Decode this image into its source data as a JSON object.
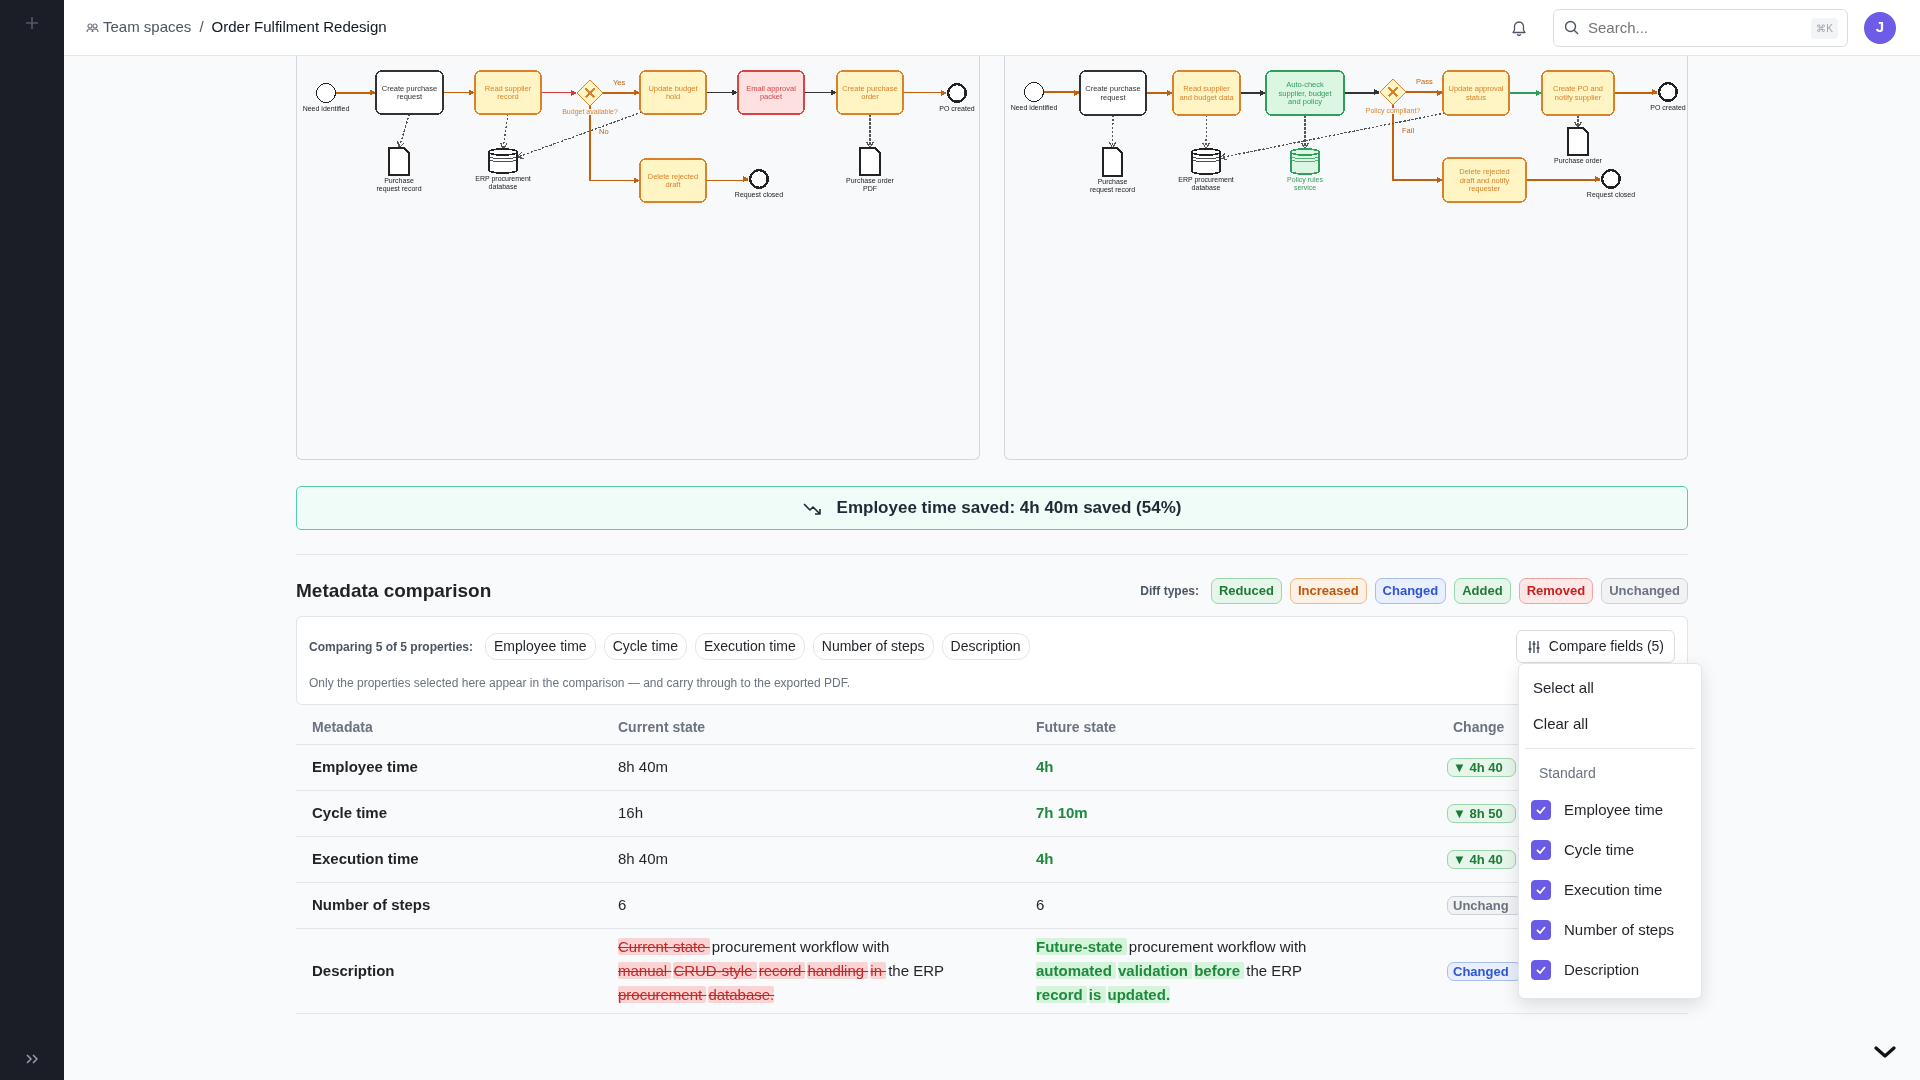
{
  "breadcrumb": {
    "parent": "Team spaces",
    "separator": "/",
    "current": "Order Fulfilment Redesign"
  },
  "search": {
    "placeholder": "Search...",
    "shortcut": "⌘K"
  },
  "avatar": "J",
  "diagrams": [
    {
      "nodes": [
        {
          "kind": "start",
          "label": "Need identified",
          "color": "#222222"
        },
        {
          "kind": "task",
          "label": "Create purchase request",
          "color": "#333333"
        },
        {
          "kind": "task",
          "label": "Read supplier record",
          "color": "#d9822b"
        },
        {
          "kind": "gateway",
          "label": "Budget available?",
          "color": "#d9822b"
        },
        {
          "kind": "task",
          "label": "Update budget hold",
          "color": "#d9822b"
        },
        {
          "kind": "task",
          "label": "Email approval packet",
          "color": "#d64545"
        },
        {
          "kind": "task",
          "label": "Create purchase order",
          "color": "#d9822b"
        },
        {
          "kind": "end",
          "label": "PO created",
          "color": "#222222"
        },
        {
          "kind": "document",
          "label": "Purchase request record",
          "color": "#222222"
        },
        {
          "kind": "database",
          "label": "ERP procurement database",
          "color": "#222222"
        },
        {
          "kind": "task",
          "label": "Delete rejected draft",
          "color": "#d9822b"
        },
        {
          "kind": "end",
          "label": "Request closed",
          "color": "#222222"
        },
        {
          "kind": "document",
          "label": "Purchase order PDF",
          "color": "#222222"
        }
      ],
      "edges": [
        {
          "kind": "flow",
          "color": "#c2600f"
        },
        {
          "kind": "flow",
          "color": "#c2600f"
        },
        {
          "kind": "flow",
          "color": "#d63a3a"
        },
        {
          "kind": "flow",
          "color": "#c2600f",
          "label": "Yes"
        },
        {
          "kind": "flow",
          "color": "#333333"
        },
        {
          "kind": "flow",
          "color": "#333333"
        },
        {
          "kind": "flow",
          "color": "#c2600f"
        },
        {
          "kind": "flow",
          "color": "#c2600f",
          "label": "No"
        },
        {
          "kind": "flow",
          "color": "#c2600f"
        },
        {
          "kind": "association",
          "color": "#555555"
        },
        {
          "kind": "association",
          "color": "#555555"
        },
        {
          "kind": "association",
          "color": "#555555"
        },
        {
          "kind": "association",
          "color": "#555555"
        }
      ]
    },
    {
      "nodes": [
        {
          "kind": "start",
          "label": "Need identified",
          "color": "#222222"
        },
        {
          "kind": "task",
          "label": "Create purchase request",
          "color": "#333333"
        },
        {
          "kind": "task",
          "label": "Read supplier and budget data",
          "color": "#d9822b"
        },
        {
          "kind": "task",
          "label": "Auto-check supplier, budget and policy",
          "color": "#2f9e5a"
        },
        {
          "kind": "gateway",
          "label": "Policy compliant?",
          "color": "#d9822b"
        },
        {
          "kind": "task",
          "label": "Update approval status",
          "color": "#d9822b"
        },
        {
          "kind": "task",
          "label": "Create PO and notify supplier",
          "color": "#d9822b"
        },
        {
          "kind": "end",
          "label": "PO created",
          "color": "#222222"
        },
        {
          "kind": "document",
          "label": "Purchase request record",
          "color": "#222222"
        },
        {
          "kind": "database",
          "label": "ERP procurement database",
          "color": "#222222"
        },
        {
          "kind": "database",
          "label": "Policy rules service",
          "color": "#2f9e5a"
        },
        {
          "kind": "task",
          "label": "Delete rejected draft and notify requester",
          "color": "#d9822b"
        },
        {
          "kind": "end",
          "label": "Request closed",
          "color": "#222222"
        },
        {
          "kind": "document",
          "label": "Purchase order",
          "color": "#222222"
        }
      ],
      "edges": [
        {
          "kind": "flow",
          "color": "#c2600f"
        },
        {
          "kind": "flow",
          "color": "#c2600f"
        },
        {
          "kind": "flow",
          "color": "#333333"
        },
        {
          "kind": "flow",
          "color": "#333333"
        },
        {
          "kind": "flow",
          "color": "#c2600f",
          "label": "Pass"
        },
        {
          "kind": "flow",
          "color": "#2f9e5a"
        },
        {
          "kind": "flow",
          "color": "#c2600f"
        },
        {
          "kind": "flow",
          "color": "#c2600f",
          "label": "Fail"
        },
        {
          "kind": "flow",
          "color": "#c2600f"
        },
        {
          "kind": "association",
          "color": "#555555"
        },
        {
          "kind": "association",
          "color": "#555555"
        },
        {
          "kind": "association",
          "color": "#555555"
        },
        {
          "kind": "association",
          "color": "#555555"
        },
        {
          "kind": "association",
          "color": "#555555"
        }
      ]
    }
  ],
  "savings_banner": "Employee time saved: 4h 40m saved (54%)",
  "metadata": {
    "title": "Metadata comparison",
    "diff_types_label": "Diff types:",
    "diff_types": [
      {
        "label": "Reduced",
        "kind": "reduced"
      },
      {
        "label": "Increased",
        "kind": "increased"
      },
      {
        "label": "Changed",
        "kind": "changed"
      },
      {
        "label": "Added",
        "kind": "added"
      },
      {
        "label": "Removed",
        "kind": "removed"
      },
      {
        "label": "Unchanged",
        "kind": "unchanged"
      }
    ],
    "comparing_label": "Comparing 5 of 5 properties:",
    "properties": [
      "Employee time",
      "Cycle time",
      "Execution time",
      "Number of steps",
      "Description"
    ],
    "compare_button": "Compare fields (5)",
    "note": "Only the properties selected here appear in the comparison — and carry through to the exported PDF.",
    "columns": [
      "Metadata",
      "Current state",
      "Future state",
      "Change"
    ],
    "rows": [
      {
        "kind": "value",
        "metadata": "Employee time",
        "current": "8h 40m",
        "future": "4h",
        "change": {
          "label": "▼ 4h 40",
          "kind": "reduced"
        }
      },
      {
        "kind": "value",
        "metadata": "Cycle time",
        "current": "16h",
        "future": "7h 10m",
        "change": {
          "label": "▼ 8h 50",
          "kind": "reduced"
        }
      },
      {
        "kind": "value",
        "metadata": "Execution time",
        "current": "8h 40m",
        "future": "4h",
        "change": {
          "label": "▼ 4h 40",
          "kind": "reduced"
        }
      },
      {
        "kind": "value",
        "metadata": "Number of steps",
        "current": "6",
        "future": "6",
        "change": {
          "label": "Unchang",
          "kind": "unchanged"
        }
      },
      {
        "kind": "diff",
        "metadata": "Description",
        "current": [
          {
            "text": "Current-state ",
            "kind": "removed"
          },
          {
            "text": "procurement workflow with ",
            "kind": "same"
          },
          {
            "text": "manual ",
            "kind": "removed"
          },
          {
            "text": "CRUD-style ",
            "kind": "removed"
          },
          {
            "text": "record ",
            "kind": "removed"
          },
          {
            "text": "handling ",
            "kind": "removed"
          },
          {
            "text": "in ",
            "kind": "removed"
          },
          {
            "text": "the ERP ",
            "kind": "same"
          },
          {
            "text": "procurement ",
            "kind": "removed"
          },
          {
            "text": "database.",
            "kind": "removed"
          }
        ],
        "future": [
          {
            "text": "Future-state ",
            "kind": "added"
          },
          {
            "text": "procurement workflow with ",
            "kind": "same"
          },
          {
            "text": "automated ",
            "kind": "added"
          },
          {
            "text": "validation ",
            "kind": "added"
          },
          {
            "text": "before ",
            "kind": "added"
          },
          {
            "text": "the ERP ",
            "kind": "same"
          },
          {
            "text": "record ",
            "kind": "added"
          },
          {
            "text": "is ",
            "kind": "added"
          },
          {
            "text": "updated.",
            "kind": "added"
          }
        ],
        "change": {
          "label": "Changed",
          "kind": "changed"
        }
      }
    ]
  },
  "compare_menu": {
    "actions": [
      "Select all",
      "Clear all"
    ],
    "section": "Standard",
    "options": [
      {
        "label": "Employee time",
        "checked": true
      },
      {
        "label": "Cycle time",
        "checked": true
      },
      {
        "label": "Execution time",
        "checked": true
      },
      {
        "label": "Number of steps",
        "checked": true
      },
      {
        "label": "Description",
        "checked": true
      }
    ]
  }
}
